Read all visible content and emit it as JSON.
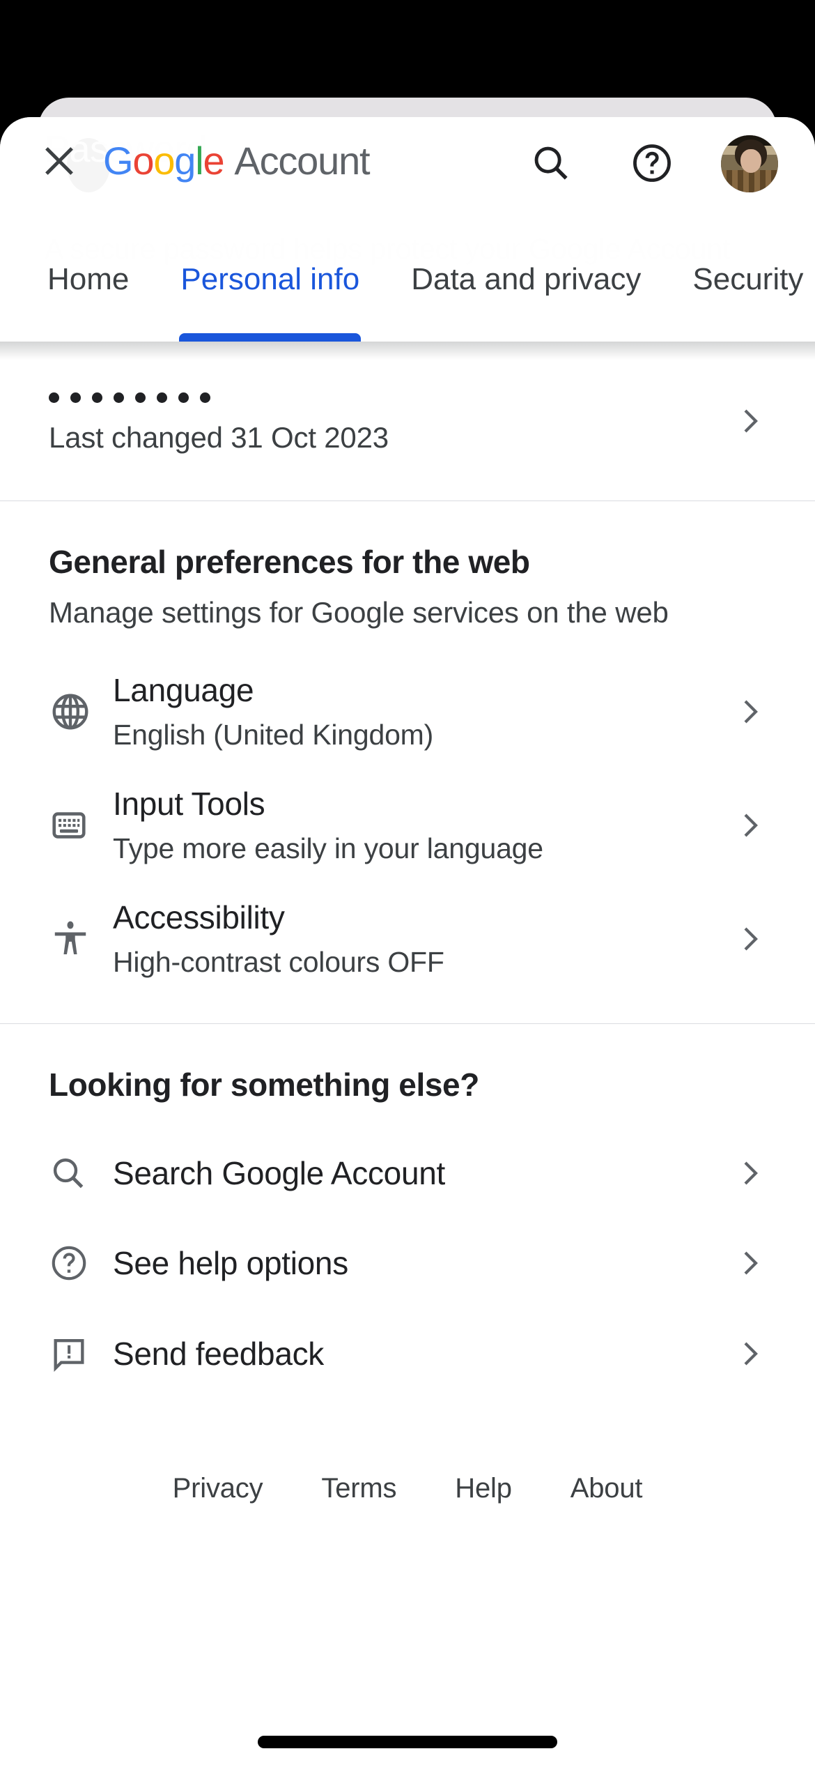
{
  "header": {
    "close_label": "Close",
    "brand": {
      "g1": "G",
      "o1": "o",
      "o2": "o",
      "g2": "g",
      "l1": "l",
      "e1": "e",
      "word": "Account"
    },
    "accent_blue": "#1a56db",
    "actions": {
      "search": "Search",
      "help": "Help"
    },
    "avatar_alt": "Google Account profile photo"
  },
  "ghost": {
    "title": "Password",
    "body": "A secure password helps protect your Google Account"
  },
  "tabs": [
    {
      "label": "Home",
      "active": false
    },
    {
      "label": "Personal info",
      "active": true
    },
    {
      "label": "Data and privacy",
      "active": false
    },
    {
      "label": "Security",
      "active": false
    }
  ],
  "password_row": {
    "masked_value": "••••••••",
    "dot_count": 8,
    "subtitle": "Last changed 31 Oct 2023"
  },
  "general_preferences": {
    "title": "General preferences for the web",
    "subtitle": "Manage settings for Google services on the web",
    "items": [
      {
        "icon": "globe-icon",
        "title": "Language",
        "desc": "English (United Kingdom)"
      },
      {
        "icon": "keyboard-icon",
        "title": "Input Tools",
        "desc": "Type more easily in your language"
      },
      {
        "icon": "accessibility-icon",
        "title": "Accessibility",
        "desc": "High-contrast colours OFF"
      }
    ]
  },
  "looking_for": {
    "title": "Looking for something else?",
    "items": [
      {
        "icon": "search-icon",
        "label": "Search Google Account"
      },
      {
        "icon": "help-circle-icon",
        "label": "See help options"
      },
      {
        "icon": "feedback-icon",
        "label": "Send feedback"
      }
    ]
  },
  "footer": {
    "links": [
      "Privacy",
      "Terms",
      "Help",
      "About"
    ]
  }
}
